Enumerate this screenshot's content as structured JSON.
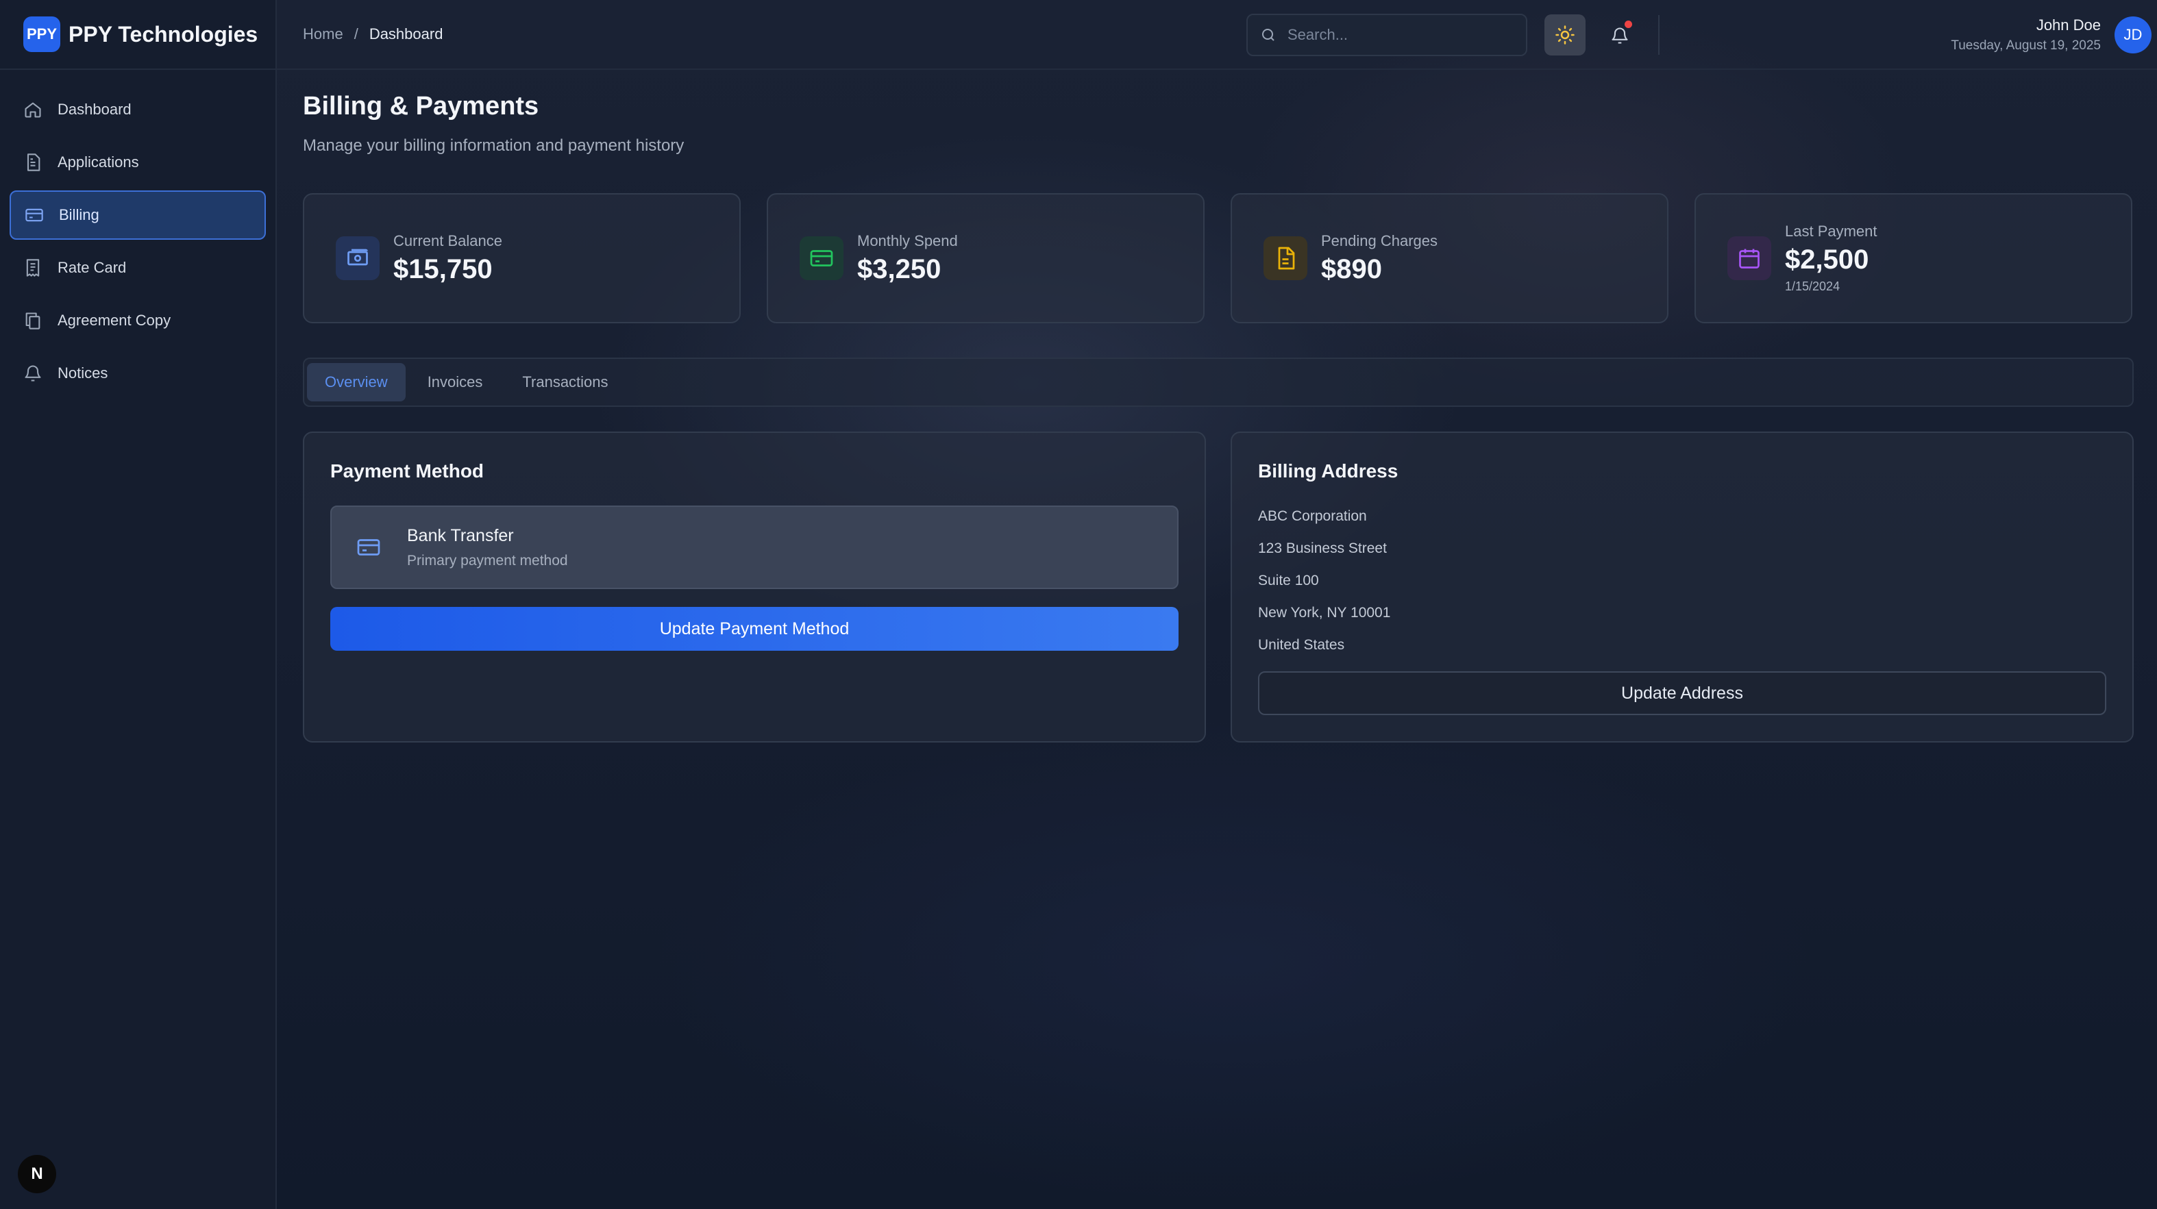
{
  "brand": {
    "logo_text": "PPY",
    "name": "PPY Technologies"
  },
  "sidebar": {
    "items": [
      {
        "label": "Dashboard",
        "icon": "home-icon"
      },
      {
        "label": "Applications",
        "icon": "document-icon"
      },
      {
        "label": "Billing",
        "icon": "credit-card-icon",
        "active": true
      },
      {
        "label": "Rate Card",
        "icon": "receipt-icon"
      },
      {
        "label": "Agreement Copy",
        "icon": "copy-icon"
      },
      {
        "label": "Notices",
        "icon": "bell-icon"
      }
    ],
    "bottom_badge": "N"
  },
  "header": {
    "breadcrumb": {
      "home": "Home",
      "separator": "/",
      "current": "Dashboard"
    },
    "search": {
      "placeholder": "Search..."
    },
    "user": {
      "name": "John Doe",
      "date": "Tuesday, August 19, 2025",
      "initials": "JD"
    },
    "notification_dot_color": "#ef4444"
  },
  "page": {
    "title": "Billing & Payments",
    "subtitle": "Manage your billing information and payment history"
  },
  "stats": [
    {
      "label": "Current Balance",
      "value": "$15,750",
      "icon": "money-icon",
      "color": "#6f9df5"
    },
    {
      "label": "Monthly Spend",
      "value": "$3,250",
      "icon": "credit-card-icon",
      "color": "#22c55e"
    },
    {
      "label": "Pending Charges",
      "value": "$890",
      "icon": "file-icon",
      "color": "#eab308"
    },
    {
      "label": "Last Payment",
      "value": "$2,500",
      "sub": "1/15/2024",
      "icon": "calendar-icon",
      "color": "#a855f7"
    }
  ],
  "tabs": [
    {
      "label": "Overview",
      "active": true
    },
    {
      "label": "Invoices"
    },
    {
      "label": "Transactions"
    }
  ],
  "payment_method": {
    "title": "Payment Method",
    "method_name": "Bank Transfer",
    "method_desc": "Primary payment method",
    "button": "Update Payment Method"
  },
  "billing_address": {
    "title": "Billing Address",
    "lines": [
      "ABC Corporation",
      "123 Business Street",
      "Suite 100",
      "New York, NY 10001",
      "United States"
    ],
    "button": "Update Address"
  },
  "colors": {
    "accent": "#2563eb",
    "active_tab": "#5b8ff0"
  }
}
